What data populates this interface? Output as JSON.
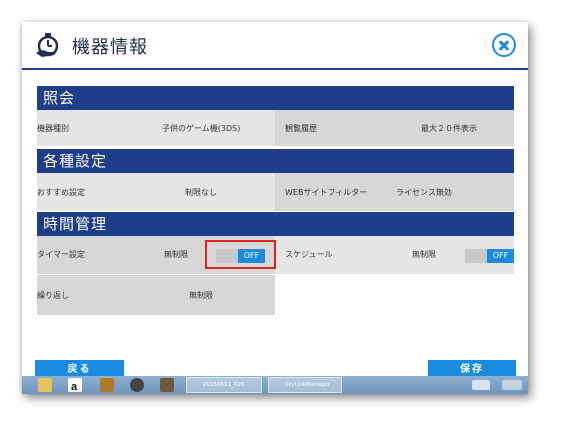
{
  "header": {
    "title": "機器情報"
  },
  "sections": {
    "inquiry": {
      "title": "照会",
      "device_type_label": "機器種別",
      "device_type_value": "子供のゲーム機(3DS)",
      "history_label": "観覧履歴",
      "history_value": "最大２０件表示"
    },
    "settings": {
      "title": "各種設定",
      "recommend_label": "おすすめ設定",
      "recommend_value": "制限なし",
      "web_filter_label": "WEBサイトフィルター",
      "web_filter_value": "ライセンス無効"
    },
    "time": {
      "title": "時間管理",
      "timer_label": "タイマー設定",
      "timer_value": "無制限",
      "timer_toggle": "OFF",
      "schedule_label": "スケジュール",
      "schedule_value": "無制限",
      "schedule_toggle": "OFF",
      "repeat_label": "繰り返し",
      "repeat_value": "無制限"
    }
  },
  "buttons": {
    "back": "戻る",
    "save": "保存"
  },
  "taskbar": {
    "task1": "20150611_026...",
    "task2": "SkyLinkManager"
  },
  "colors": {
    "section_header": "#1e3d8a",
    "accent": "#1a8be0",
    "highlight": "#e0211c"
  }
}
